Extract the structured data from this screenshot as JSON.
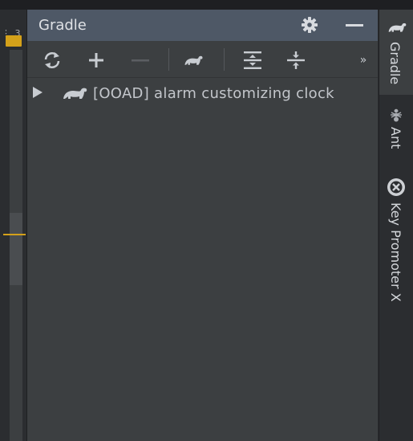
{
  "gutter": {
    "label": "⋮ 3"
  },
  "panel": {
    "title": "Gradle",
    "header_buttons": [
      {
        "name": "settings",
        "icon": "gear-icon"
      },
      {
        "name": "hide",
        "icon": "minimize-icon"
      }
    ],
    "toolbar": [
      {
        "name": "reload-all-gradle-projects",
        "icon": "refresh-icon"
      },
      {
        "name": "link-gradle-project",
        "icon": "plus-icon"
      },
      {
        "name": "unlink-gradle-project",
        "icon": "minus-icon",
        "disabled": true
      },
      {
        "name": "execute-gradle-task",
        "icon": "elephant-icon"
      },
      {
        "name": "expand-all",
        "icon": "expand-all-icon"
      },
      {
        "name": "collapse-all",
        "icon": "collapse-all-icon"
      },
      {
        "name": "more",
        "icon": "chevron-double-right-icon",
        "label": "»"
      }
    ],
    "tree": [
      {
        "label": "[OOAD] alarm customizing clock",
        "icon": "elephant-icon",
        "expanded": false
      }
    ]
  },
  "right_strip": {
    "tabs": [
      {
        "label": "Gradle",
        "icon": "elephant-icon",
        "active": true
      },
      {
        "label": "Ant",
        "icon": "ant-icon",
        "active": false
      },
      {
        "label": "Key Promoter X",
        "icon": "key-promoter-icon",
        "active": false
      }
    ]
  },
  "colors": {
    "header_bg": "#4e5866",
    "panel_bg": "#3c3f41",
    "accent_marker": "#d4a11a"
  }
}
